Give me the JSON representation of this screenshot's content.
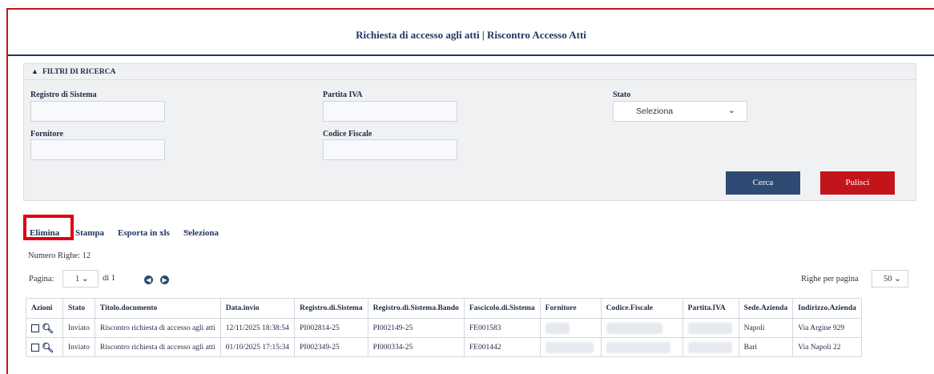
{
  "page_title": "Richiesta di accesso agli atti | Riscontro Accesso Atti",
  "filters": {
    "header": "FILTRI DI RICERCA",
    "registro_label": "Registro di Sistema",
    "partita_label": "Partita IVA",
    "stato_label": "Stato",
    "stato_value": "Seleziona",
    "fornitore_label": "Fornitore",
    "codice_label": "Codice Fiscale",
    "cerca": "Cerca",
    "pulisci": "Pulisci"
  },
  "toolbar": {
    "elimina": "Elimina",
    "stampa": "Stampa",
    "esporta": "Esporta in xls",
    "seleziona": "Seleziona"
  },
  "numero_righe": "Numero Righe: 12",
  "pagination": {
    "pagina_label": "Pagina:",
    "page": "1",
    "di": "di 1",
    "righe_label": "Righe per pagina",
    "righe_value": "50"
  },
  "table": {
    "headers": [
      "Azioni",
      "Stato",
      "Titolo.documento",
      "Data.invio",
      "Registro.di.Sistema",
      "Registro.di.Sistema.Bando",
      "Fascicolo.di.Sistema",
      "Fornitore",
      "Codice.Fiscale",
      "Partita.IVA",
      "Sede.Azienda",
      "Indirizzo.Azienda"
    ],
    "rows": [
      {
        "stato": "Inviato",
        "titolo": "Riscontro richiesta di accesso agli atti",
        "data": "12/11/2025 18:38:54",
        "registro": "PI002814-25",
        "registro_bando": "PI002149-25",
        "fascicolo": "FE001583",
        "sede": "Napoli",
        "indirizzo": "Via Argine 929"
      },
      {
        "stato": "Inviato",
        "titolo": "Riscontro richiesta di accesso agli atti",
        "data": "01/10/2025 17:15:34",
        "registro": "PI002349-25",
        "registro_bando": "PI000334-25",
        "fascicolo": "FE001442",
        "sede": "Bari",
        "indirizzo": "Via Napoli 22"
      }
    ]
  }
}
